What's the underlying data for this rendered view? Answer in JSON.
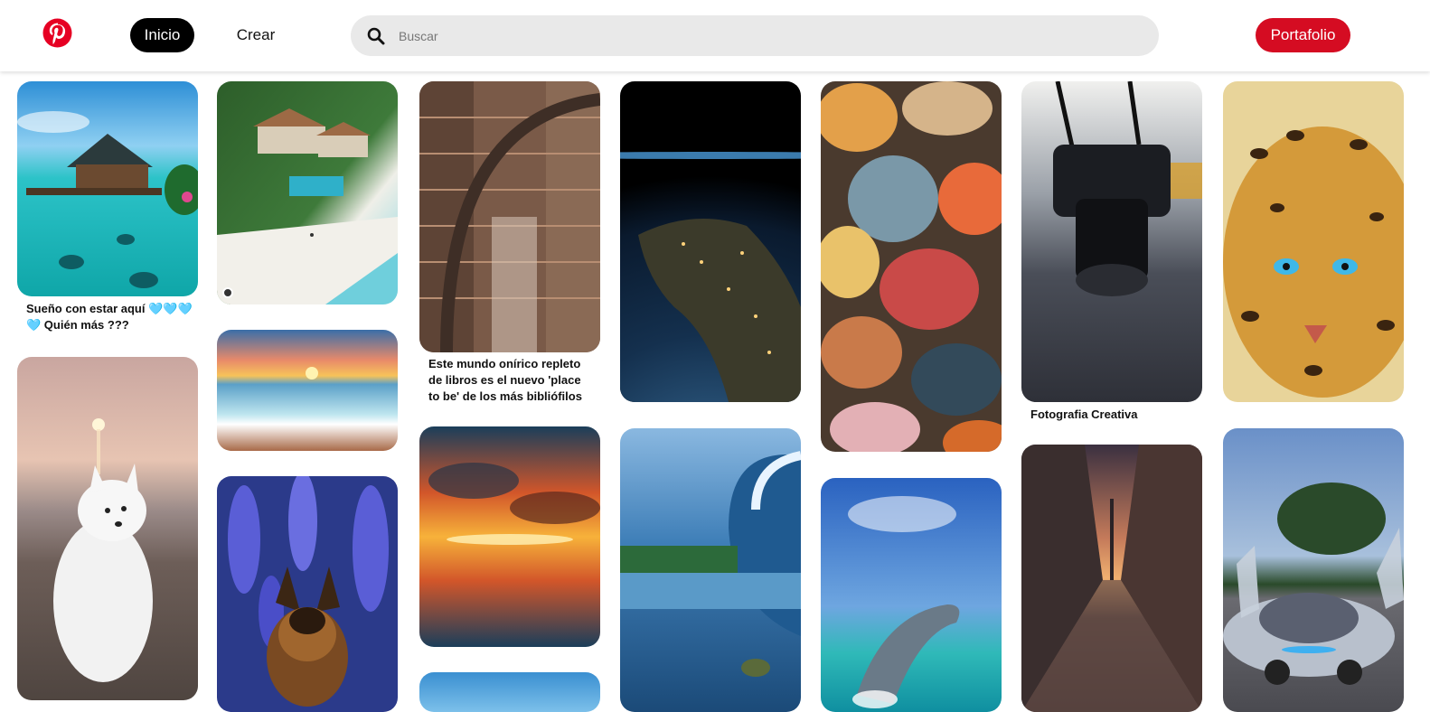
{
  "header": {
    "logo_icon": "pinterest-logo-icon",
    "brand_color": "#e60023",
    "nav": [
      {
        "label": "Inicio",
        "active": true
      },
      {
        "label": "Crear",
        "active": false
      }
    ],
    "search": {
      "placeholder": "Buscar",
      "value": "",
      "icon": "search-icon"
    },
    "portfolio_label": "Portafolio",
    "portfolio_color": "#d50c22"
  },
  "pins": [
    {
      "column": 1,
      "subject": "overwater bungalow tropical sea",
      "caption": "Sueño con estar aquí 🩵🩵🩵 🩵 Quién más ???"
    },
    {
      "column": 1,
      "subject": "white samoyed puppy on beach at sunset",
      "caption": ""
    },
    {
      "column": 2,
      "subject": "aerial tropical villa with pool and beach",
      "caption": ""
    },
    {
      "column": 2,
      "subject": "sunset over sea waves on shore",
      "caption": ""
    },
    {
      "column": 2,
      "subject": "german shepherd among purple flowers",
      "caption": ""
    },
    {
      "column": 3,
      "subject": "library with spiral staircase and bookshelves",
      "caption": "Este mundo onírico repleto de libros es el nuevo 'place to be' de los más bibliófilos"
    },
    {
      "column": 3,
      "subject": "fiery sunset clouds reflected on beach",
      "caption": ""
    },
    {
      "column": 3,
      "subject": "blue sky",
      "caption": ""
    },
    {
      "column": 4,
      "subject": "earth from space at night with city lights",
      "caption": ""
    },
    {
      "column": 4,
      "subject": "painted ocean wave with sea turtles",
      "caption": ""
    },
    {
      "column": 5,
      "subject": "colorful polished stones",
      "caption": ""
    },
    {
      "column": 5,
      "subject": "dolphin jumping out of the sea",
      "caption": ""
    },
    {
      "column": 6,
      "subject": "nikon camera hanging over railway",
      "caption": "Fotografia Creativa"
    },
    {
      "column": 6,
      "subject": "rainy city street at sunset",
      "caption": ""
    },
    {
      "column": 7,
      "subject": "artistic golden leopard with blue eyes",
      "caption": ""
    },
    {
      "column": 7,
      "subject": "silver concept car with open doors",
      "caption": ""
    }
  ]
}
